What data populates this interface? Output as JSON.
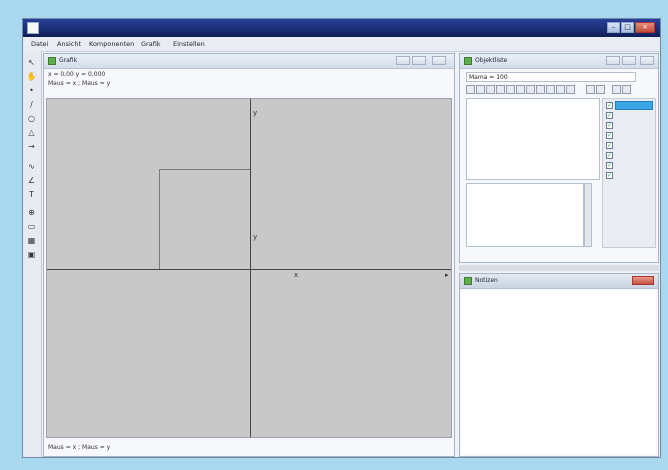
{
  "window": {
    "title": "",
    "controls": {
      "minimize": "–",
      "maximize": "□",
      "close": "×"
    }
  },
  "menu": [
    {
      "label": "Datei"
    },
    {
      "label": "Ansicht"
    },
    {
      "label": "Komponenten"
    },
    {
      "label": "Grafik"
    },
    {
      "label": "Einstellen"
    }
  ],
  "tools": [
    {
      "icon": "pointer-icon",
      "glyph": "↖"
    },
    {
      "icon": "hand-icon",
      "glyph": "✋"
    },
    {
      "icon": "point-icon",
      "glyph": "•"
    },
    {
      "icon": "line-icon",
      "glyph": "/"
    },
    {
      "icon": "circle-icon",
      "glyph": "○"
    },
    {
      "icon": "polygon-icon",
      "glyph": "△"
    },
    {
      "icon": "vector-icon",
      "glyph": "→"
    },
    {
      "icon": "curve-icon",
      "glyph": "∿"
    },
    {
      "icon": "angle-icon",
      "glyph": "∠"
    },
    {
      "icon": "text-icon",
      "glyph": "T"
    },
    {
      "icon": "zoom-icon",
      "glyph": "⊕"
    },
    {
      "icon": "ruler-icon",
      "glyph": "▭"
    },
    {
      "icon": "graph-icon",
      "glyph": "▦"
    },
    {
      "icon": "settings-icon",
      "glyph": "▣"
    }
  ],
  "graphics": {
    "title": "Grafik",
    "coords_line": "x = 0,00   y = 0,000",
    "info_line": "Maus = x ; Maus = y",
    "status_bottom": "Maus = x ; Maus = y",
    "axis_labels": {
      "y": "y",
      "x": "x"
    }
  },
  "object_list": {
    "title": "Objektliste",
    "select_value": "Mama = 100",
    "checkbox_count": 8
  },
  "bottom_panel": {
    "title": "Notizen"
  }
}
